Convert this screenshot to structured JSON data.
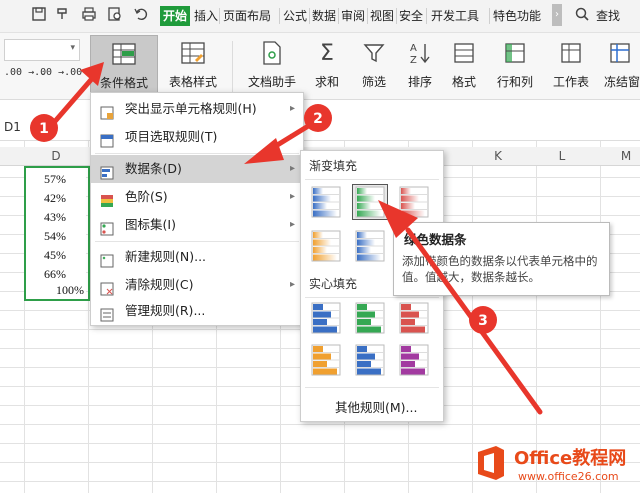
{
  "menubar": {
    "tabs": [
      "开始",
      "插入",
      "页面布局",
      "公式",
      "数据",
      "审阅",
      "视图",
      "安全",
      "开发工具",
      "特色功能"
    ],
    "search_label": "查找"
  },
  "ribbon": {
    "number_formats": [
      ".00 →.0",
      ".0 →.00"
    ],
    "buttons": [
      "条件格式",
      "表格样式",
      "文档助手",
      "求和",
      "筛选",
      "排序",
      "格式",
      "行和列",
      "工作表",
      "冻结窗"
    ]
  },
  "sheet": {
    "name_box": "D1",
    "columns": [
      "D",
      "K",
      "L",
      "M"
    ],
    "cells": [
      "57%",
      "42%",
      "43%",
      "54%",
      "45%",
      "66%",
      "100%"
    ]
  },
  "main_menu": {
    "items": [
      "突出显示单元格规则(H)",
      "项目选取规则(T)",
      "数据条(D)",
      "色阶(S)",
      "图标集(I)",
      "新建规则(N)...",
      "清除规则(C)",
      "管理规则(R)..."
    ]
  },
  "submenu": {
    "gradient_header": "渐变填充",
    "solid_header": "实心填充",
    "other_rules": "其他规则(M)..."
  },
  "tooltip": {
    "title": "绿色数据条",
    "body": "添加带颜色的数据条以代表单元格中的值。值越大，数据条越长。"
  },
  "annotations": {
    "steps": [
      "1",
      "2",
      "3"
    ],
    "arrow_color": "#e8362c"
  },
  "watermark": {
    "title": "Office教程网",
    "url": "www.office26.com"
  },
  "colors": {
    "active_tab": "#1f9b3b",
    "selection": "#2e9e49",
    "bar_blue": "#3a6fc4",
    "bar_green": "#35a853",
    "bar_red": "#d9534f",
    "bar_orange": "#f0a030",
    "bar_purple": "#a23aa0"
  }
}
